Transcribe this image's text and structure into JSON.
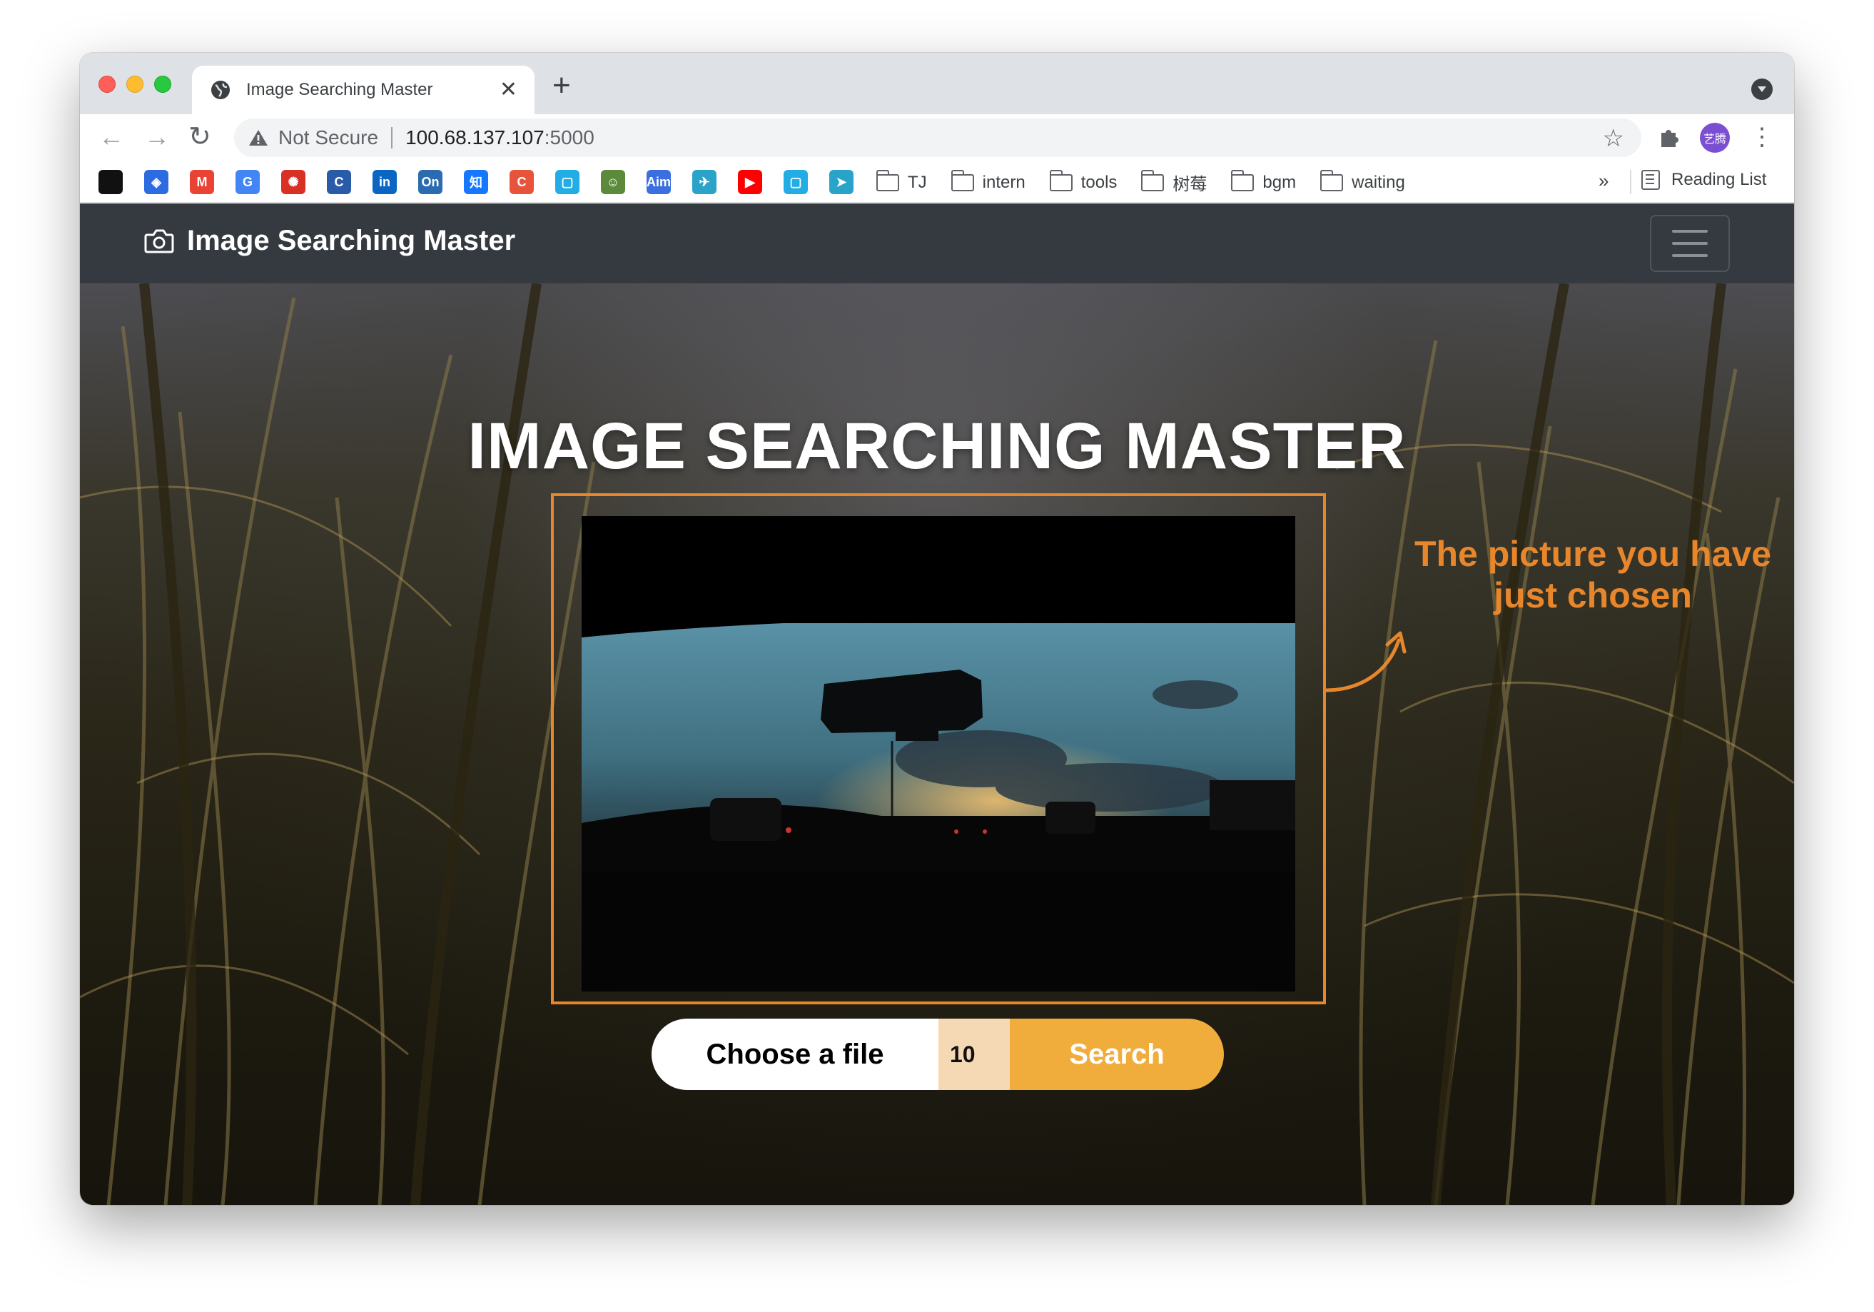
{
  "browser": {
    "tab_title": "Image Searching Master",
    "tab_close": "✕",
    "new_tab": "+",
    "address": {
      "security_label": "Not Secure",
      "host": "100.68.137.107",
      "port": ":5000"
    },
    "profile_initials": "艺腾",
    "bookmark_icons": [
      {
        "name": "github",
        "glyph": "",
        "color": "#111111"
      },
      {
        "name": "diamond",
        "glyph": "◈",
        "color": "#2d6be0"
      },
      {
        "name": "gmail",
        "glyph": "M",
        "color": "#ea4335"
      },
      {
        "name": "translate",
        "glyph": "G",
        "color": "#4285f4"
      },
      {
        "name": "snowflake",
        "glyph": "✺",
        "color": "#d93025"
      },
      {
        "name": "c-blue",
        "glyph": "C",
        "color": "#2a5ba8"
      },
      {
        "name": "linkedin",
        "glyph": "in",
        "color": "#0a66c2"
      },
      {
        "name": "onenote",
        "glyph": "On",
        "color": "#2b6cb0"
      },
      {
        "name": "zhihu",
        "glyph": "知",
        "color": "#1677ff"
      },
      {
        "name": "c-red",
        "glyph": "C",
        "color": "#e8533b"
      },
      {
        "name": "bilibili",
        "glyph": "▢",
        "color": "#23ade5"
      },
      {
        "name": "avatar-bm",
        "glyph": "☺",
        "color": "#5a8a3a"
      },
      {
        "name": "aim",
        "glyph": "Aim",
        "color": "#3b6fe0"
      },
      {
        "name": "bird",
        "glyph": "✈",
        "color": "#2aa3c9"
      },
      {
        "name": "youtube",
        "glyph": "▶",
        "color": "#ff0000"
      },
      {
        "name": "bilibili-2",
        "glyph": "▢",
        "color": "#23ade5"
      },
      {
        "name": "telegram",
        "glyph": "➤",
        "color": "#2aa3c9"
      }
    ],
    "bookmark_folders": [
      "TJ",
      "intern",
      "tools",
      "树莓",
      "bgm",
      "waiting"
    ],
    "bookmarks_more": "»",
    "reading_list": "Reading List"
  },
  "navbar": {
    "brand": "Image Searching Master"
  },
  "hero": {
    "title": "IMAGE SEARCHING MASTER",
    "annotation": "The picture you have just chosen"
  },
  "search": {
    "choose_label": "Choose a file",
    "count_value": "10",
    "search_label": "Search"
  },
  "colors": {
    "accent": "#e8862c",
    "search_button": "#f0ad3c",
    "count_field": "#f5d9b4",
    "navbar": "#343a40"
  }
}
